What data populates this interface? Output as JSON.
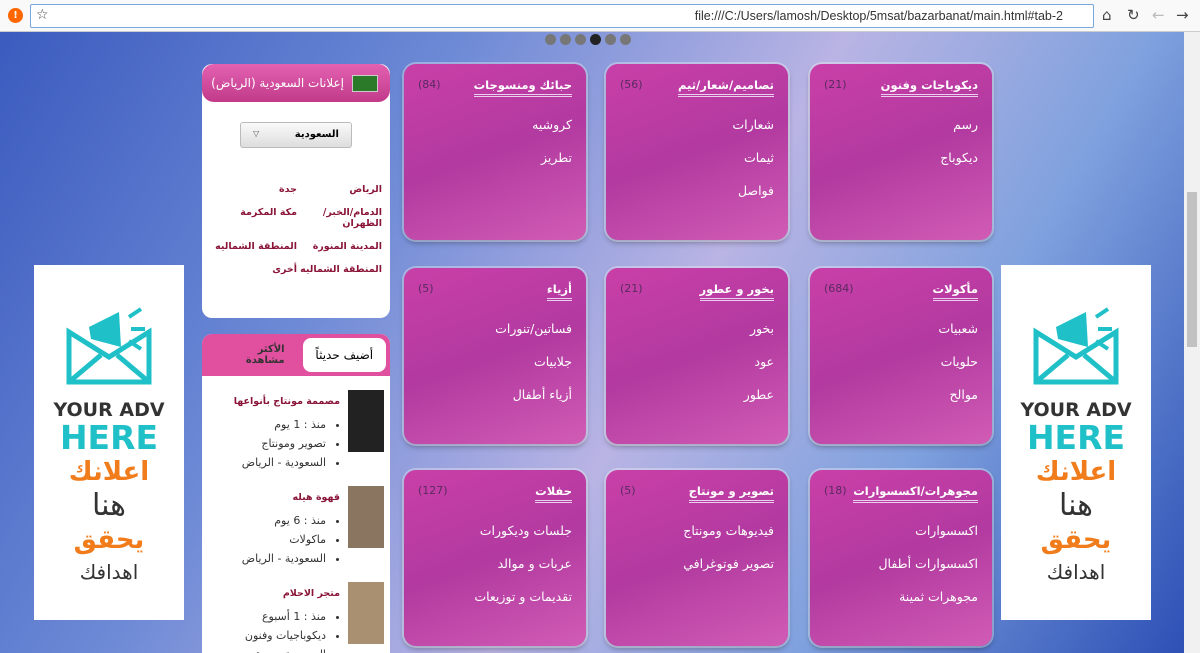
{
  "browser": {
    "url": "file:///C:/Users/lamosh/Desktop/5msat/bazarbanat/main.html#tab-2"
  },
  "carousel": {
    "count": 6,
    "active": 3
  },
  "region": {
    "title": "إعلانات السعودية (الرياض)",
    "country": "السعودية",
    "cities": [
      "الرياض",
      "جدة",
      "الدمام/الخبر/الظهران",
      "مكة المكرمة",
      "المدينة المنورة",
      "المنطقة الشماليه",
      "المنطقة الشماليه",
      "أخرى"
    ]
  },
  "tabs": {
    "newest": "أضيف حديثاً",
    "most_viewed": "الأكثر مشاهدة"
  },
  "posts": [
    {
      "title": "مصممة مونتاج بأنواعها",
      "time": "منذ : 1 يوم",
      "category": "تصوير ومونتاج",
      "location": "السعودية - الرياض"
    },
    {
      "title": "قهوة هيله",
      "time": "منذ : 6 يوم",
      "category": "ماكولات",
      "location": "السعودية - الرياض"
    },
    {
      "title": "متجر الاحلام",
      "time": "منذ : 1 أسبوع",
      "category": "ديكوباجيات وفنون",
      "location": "السعودية - جدة"
    }
  ],
  "ads": {
    "l1": "YOUR ADV",
    "l2": "HERE",
    "a1": "اعلانك",
    "a2": "هنا",
    "a3": "يحقق",
    "a4": "اهدافك"
  },
  "categories": [
    {
      "title": "ديكوباجات وفنون",
      "count": "(21)",
      "items": [
        "رسم",
        "ديكوباج"
      ]
    },
    {
      "title": "تصاميم/شعار/ثيم",
      "count": "(56)",
      "items": [
        "شعارات",
        "ثيمات",
        "فواصل"
      ]
    },
    {
      "title": "حبائك ومنسوجات",
      "count": "(84)",
      "items": [
        "كروشيه",
        "تطريز"
      ]
    },
    {
      "title": "مأكولات",
      "count": "(684)",
      "items": [
        "شعبيات",
        "حلويات",
        "موالح"
      ]
    },
    {
      "title": "بخور و عطور",
      "count": "(21)",
      "items": [
        "بخور",
        "عود",
        "عطور"
      ]
    },
    {
      "title": "أزياء",
      "count": "(5)",
      "items": [
        "فساتين/تنورات",
        "جلابيات",
        "أزياء أطفال"
      ]
    },
    {
      "title": "مجوهرات/اكسسوارات",
      "count": "(18)",
      "items": [
        "اكسسوارات",
        "اكسسوارات أطفال",
        "مجوهرات ثمينة"
      ]
    },
    {
      "title": "تصوير و مونتاج",
      "count": "(5)",
      "items": [
        "فيديوهات ومونتاج",
        "تصوير فوتوغرافي"
      ]
    },
    {
      "title": "حفلات",
      "count": "(127)",
      "items": [
        "جلسات وديكورات",
        "عربات و موالد",
        "تقديمات و توزيعات"
      ]
    }
  ]
}
